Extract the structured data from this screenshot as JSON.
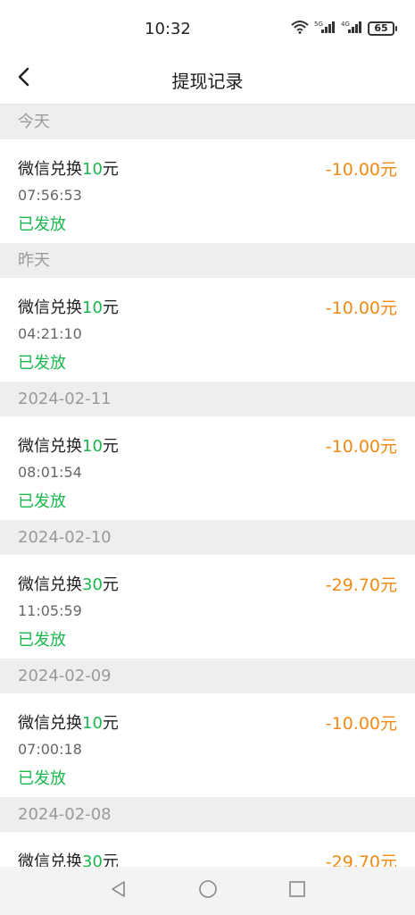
{
  "status_bar": {
    "time": "10:32",
    "icons": [
      "wifi-icon",
      "signal-5g-icon",
      "signal-4g-icon"
    ],
    "battery": "65"
  },
  "header": {
    "title": "提现记录",
    "back_icon": "chevron-left-icon"
  },
  "sections": [
    {
      "label": "今天",
      "records": [
        {
          "title_prefix": "微信兑换",
          "title_amount": "10",
          "title_suffix": "元",
          "time": "07:56:53",
          "status": "已发放",
          "amount": "-10.00元"
        }
      ]
    },
    {
      "label": "昨天",
      "records": [
        {
          "title_prefix": "微信兑换",
          "title_amount": "10",
          "title_suffix": "元",
          "time": "04:21:10",
          "status": "已发放",
          "amount": "-10.00元"
        }
      ]
    },
    {
      "label": "2024-02-11",
      "records": [
        {
          "title_prefix": "微信兑换",
          "title_amount": "10",
          "title_suffix": "元",
          "time": "08:01:54",
          "status": "已发放",
          "amount": "-10.00元"
        }
      ]
    },
    {
      "label": "2024-02-10",
      "records": [
        {
          "title_prefix": "微信兑换",
          "title_amount": "30",
          "title_suffix": "元",
          "time": "11:05:59",
          "status": "已发放",
          "amount": "-29.70元"
        }
      ]
    },
    {
      "label": "2024-02-09",
      "records": [
        {
          "title_prefix": "微信兑换",
          "title_amount": "10",
          "title_suffix": "元",
          "time": "07:00:18",
          "status": "已发放",
          "amount": "-10.00元"
        }
      ]
    },
    {
      "label": "2024-02-08",
      "records": [
        {
          "title_prefix": "微信兑换",
          "title_amount": "30",
          "title_suffix": "元",
          "time": "",
          "status": "",
          "amount": "-29.70元"
        }
      ]
    }
  ],
  "colors": {
    "accent_green": "#1ab84e",
    "amount_orange": "#f08a14",
    "section_bg": "#eeeeee"
  },
  "bottom_nav": {
    "icons": [
      "back-triangle-icon",
      "home-circle-icon",
      "recents-square-icon"
    ]
  }
}
